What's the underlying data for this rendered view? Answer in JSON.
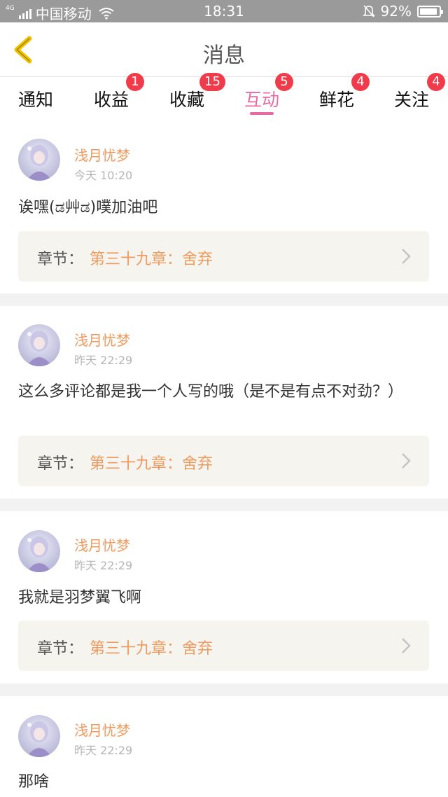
{
  "status_bar": {
    "network": "4G",
    "carrier": "中国移动",
    "time": "18:31",
    "battery": "92%",
    "battery_level": 0.92,
    "icons": [
      "signal-icon",
      "wifi-icon",
      "bell-muted-icon",
      "battery-icon"
    ]
  },
  "nav": {
    "title": "消息",
    "back_icon": "chevron-left-icon",
    "back_color": "#f2c200"
  },
  "tabs": [
    {
      "label": "通知",
      "badge": ""
    },
    {
      "label": "收益",
      "badge": "1"
    },
    {
      "label": "收藏",
      "badge": "15"
    },
    {
      "label": "互动",
      "badge": "5"
    },
    {
      "label": "鲜花",
      "badge": "4"
    },
    {
      "label": "关注",
      "badge": "4"
    }
  ],
  "active_tab": "互动",
  "colors": {
    "accent_pink": "#e96aa0",
    "username_orange": "#ef9a5e",
    "badge_red": "#f03c4a",
    "chapter_bg": "#f5f4ef"
  },
  "items": [
    {
      "username": "浅月忧梦",
      "time": "今天 10:20",
      "comment": "诶嘿(ಡ艸ಡ)噗加油吧",
      "chapter_label": "章节：",
      "chapter_title": "第三十九章：舍弃"
    },
    {
      "username": "浅月忧梦",
      "time": "昨天 22:29",
      "comment": "这么多评论都是我一个人写的哦（是不是有点不对劲？）",
      "chapter_label": "章节：",
      "chapter_title": "第三十九章：舍弃"
    },
    {
      "username": "浅月忧梦",
      "time": "昨天 22:29",
      "comment": "我就是羽梦翼飞啊",
      "chapter_label": "章节：",
      "chapter_title": "第三十九章：舍弃"
    },
    {
      "username": "浅月忧梦",
      "time": "昨天 22:29",
      "comment": "那啥"
    }
  ]
}
